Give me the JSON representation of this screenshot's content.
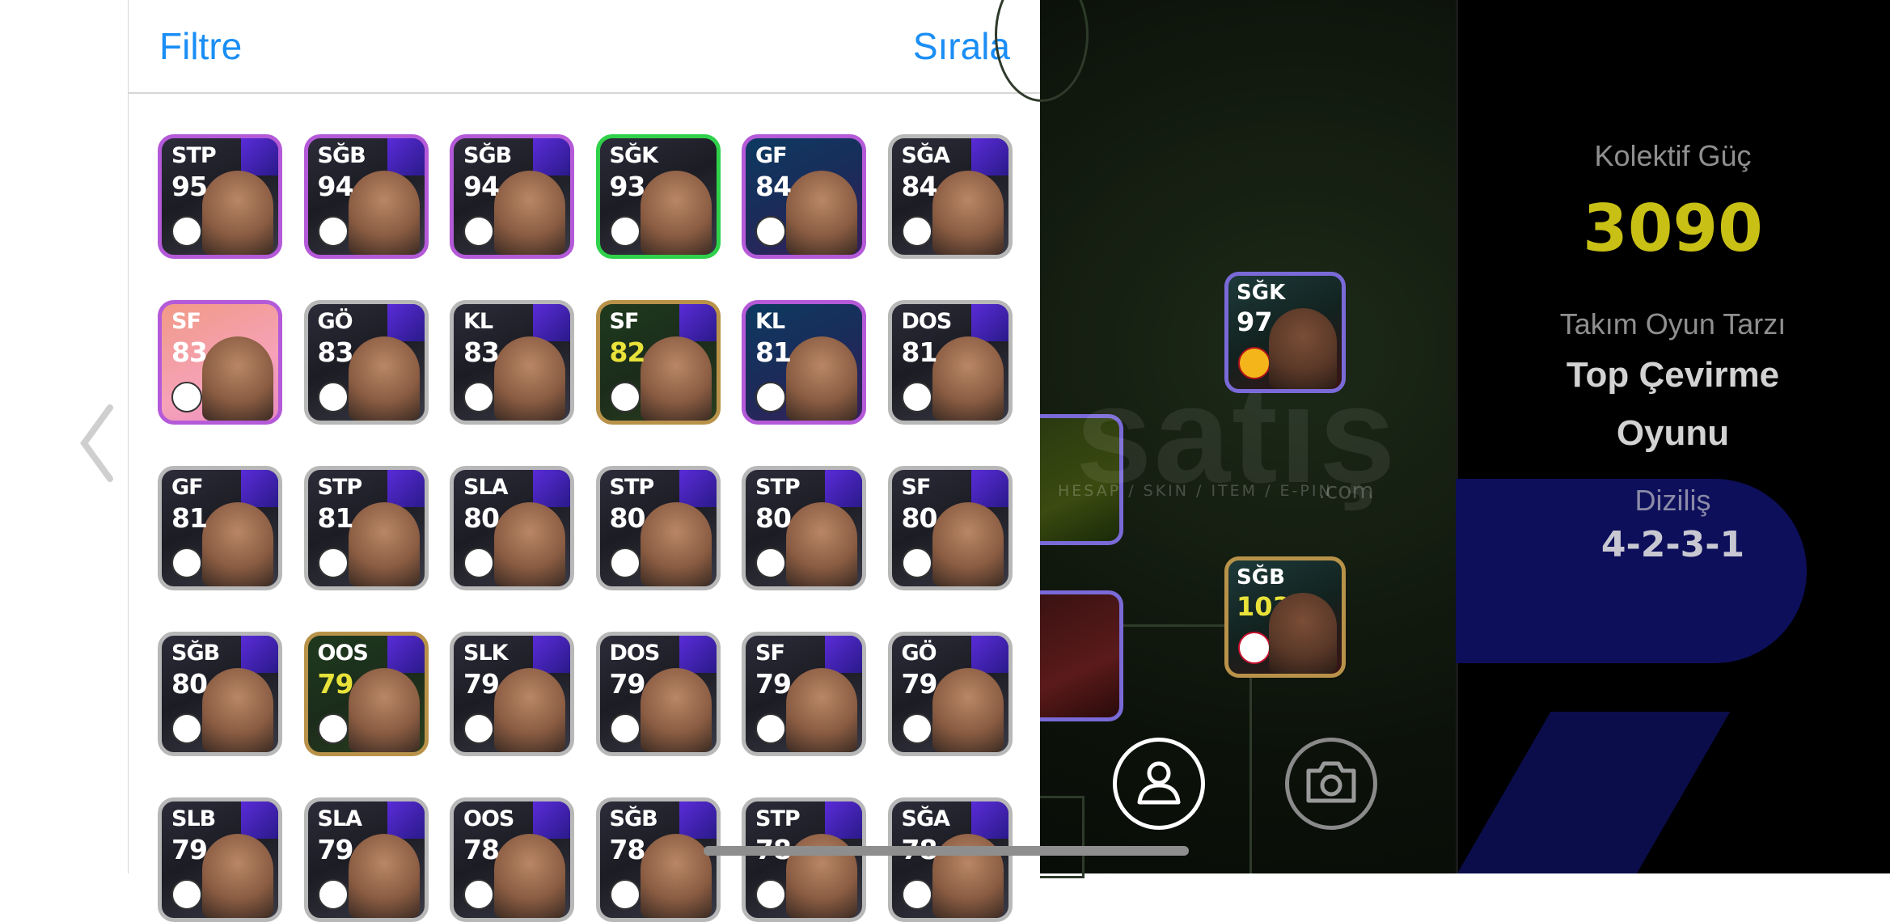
{
  "header": {
    "filter_label": "Filtre",
    "sort_label": "Sırala"
  },
  "players": [
    {
      "pos": "STP",
      "ovr": "95"
    },
    {
      "pos": "SĞB",
      "ovr": "94"
    },
    {
      "pos": "SĞB",
      "ovr": "94"
    },
    {
      "pos": "SĞK",
      "ovr": "93"
    },
    {
      "pos": "GF",
      "ovr": "84"
    },
    {
      "pos": "SĞA",
      "ovr": "84"
    },
    {
      "pos": "SF",
      "ovr": "83"
    },
    {
      "pos": "GÖ",
      "ovr": "83"
    },
    {
      "pos": "KL",
      "ovr": "83"
    },
    {
      "pos": "SF",
      "ovr": "82"
    },
    {
      "pos": "KL",
      "ovr": "81"
    },
    {
      "pos": "DOS",
      "ovr": "81"
    },
    {
      "pos": "GF",
      "ovr": "81"
    },
    {
      "pos": "STP",
      "ovr": "81"
    },
    {
      "pos": "SLA",
      "ovr": "80"
    },
    {
      "pos": "STP",
      "ovr": "80"
    },
    {
      "pos": "STP",
      "ovr": "80"
    },
    {
      "pos": "SF",
      "ovr": "80"
    },
    {
      "pos": "SĞB",
      "ovr": "80"
    },
    {
      "pos": "OOS",
      "ovr": "79"
    },
    {
      "pos": "SLK",
      "ovr": "79"
    },
    {
      "pos": "DOS",
      "ovr": "79"
    },
    {
      "pos": "SF",
      "ovr": "79"
    },
    {
      "pos": "GÖ",
      "ovr": "79"
    },
    {
      "pos": "SLB",
      "ovr": "79"
    },
    {
      "pos": "SLA",
      "ovr": "79"
    },
    {
      "pos": "OOS",
      "ovr": "78"
    },
    {
      "pos": "SĞB",
      "ovr": "78"
    },
    {
      "pos": "STP",
      "ovr": "78"
    },
    {
      "pos": "SĞA",
      "ovr": "78"
    }
  ],
  "field_players": [
    {
      "pos": "SĞK",
      "ovr": "97"
    },
    {
      "pos": "SĞB",
      "ovr": "103"
    }
  ],
  "watermark": {
    "brand": "satış",
    "tagline": "HESAP / SKIN / ITEM / E-PIN",
    "domain": ".com"
  },
  "team_info": {
    "collective_label": "Kolektif Güç",
    "collective_value": "3090",
    "playstyle_label": "Takım Oyun Tarzı",
    "playstyle_line1": "Top Çevirme",
    "playstyle_line2": "Oyunu",
    "formation_label": "Diziliş",
    "formation_value": "4-2-3-1"
  },
  "icons": {
    "back": "chevron-left-icon",
    "profile": "person-icon",
    "camera": "camera-icon"
  },
  "colors": {
    "accent": "#1a8ef5",
    "collective": "#c8c015",
    "formation_bg": "#0d0f5a"
  }
}
